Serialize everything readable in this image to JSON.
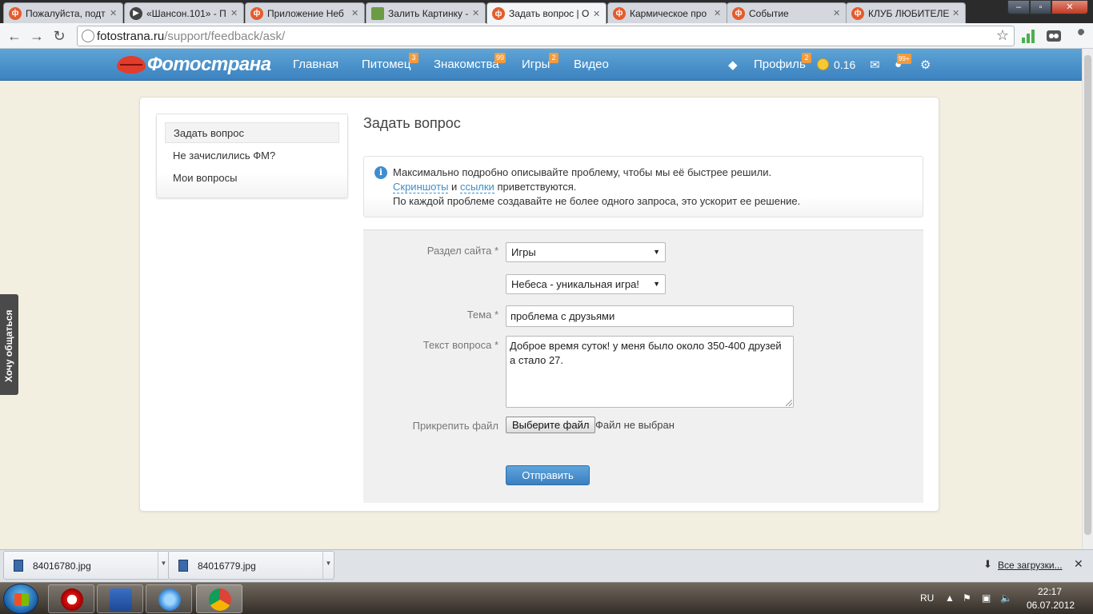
{
  "browser": {
    "tabs": [
      {
        "label": "Пожалуйста, подт",
        "icon": "opera-page-icon"
      },
      {
        "label": "«Шансон.101» - П",
        "icon": "play-icon"
      },
      {
        "label": "Приложение Неб",
        "icon": "fotostrana-icon"
      },
      {
        "label": "Залить Картинку -",
        "icon": "image-icon"
      },
      {
        "label": "Задать вопрос | О",
        "icon": "fotostrana-icon",
        "active": true
      },
      {
        "label": "Кармическое про",
        "icon": "fotostrana-icon"
      },
      {
        "label": "Событие",
        "icon": "fotostrana-icon"
      },
      {
        "label": "КЛУБ ЛЮБИТЕЛЕ",
        "icon": "fotostrana-icon"
      }
    ],
    "url_domain": "fotostrana.ru",
    "url_path": "/support/feedback/ask/"
  },
  "site": {
    "logo": "Фотострана",
    "menu": [
      {
        "label": "Главная"
      },
      {
        "label": "Питомец",
        "badge": "3"
      },
      {
        "label": "Знакомства",
        "badge": "99"
      },
      {
        "label": "Игры",
        "badge": "2"
      },
      {
        "label": "Видео"
      }
    ],
    "profile": {
      "label": "Профиль",
      "badge": "2"
    },
    "balance": "0.16",
    "notifications_badge": "99+"
  },
  "side_tab": "Хочу общаться",
  "sidebar": {
    "items": [
      {
        "label": "Задать вопрос",
        "active": true
      },
      {
        "label": "Не зачислились ФМ?"
      },
      {
        "label": "Мои вопросы"
      }
    ]
  },
  "page_title": "Задать вопрос",
  "info": {
    "line1": "Максимально подробно описывайте проблему, чтобы мы её быстрее решили.",
    "link_screenshots": "Скриншоты",
    "conjunction": "и",
    "link_links": "ссылки",
    "line2_tail": "приветствуются.",
    "line3": "По каждой проблеме создавайте не более одного запроса, это ускорит ее решение."
  },
  "form": {
    "section_label": "Раздел сайта *",
    "section_value": "Игры",
    "subsection_value": "Небеса - уникальная игра!",
    "topic_label": "Тема *",
    "topic_value": "проблема с друзьями",
    "text_label": "Текст вопроса *",
    "text_value": "Доброе время суток! у меня было около 350-400 друзей а стало 27.",
    "attach_label": "Прикрепить файл",
    "file_button": "Выберите файл",
    "file_status": "Файл не выбран",
    "submit": "Отправить"
  },
  "downloads": {
    "items": [
      "84016780.jpg",
      "84016779.jpg"
    ],
    "all_label": "Все загрузки..."
  },
  "taskbar": {
    "lang": "RU",
    "time": "22:17",
    "date": "06.07.2012"
  },
  "colors": {
    "header_blue": "#3b82c0",
    "accent_orange": "#f39b3c",
    "page_bg": "#f3efe0",
    "link": "#3d8ec8"
  }
}
